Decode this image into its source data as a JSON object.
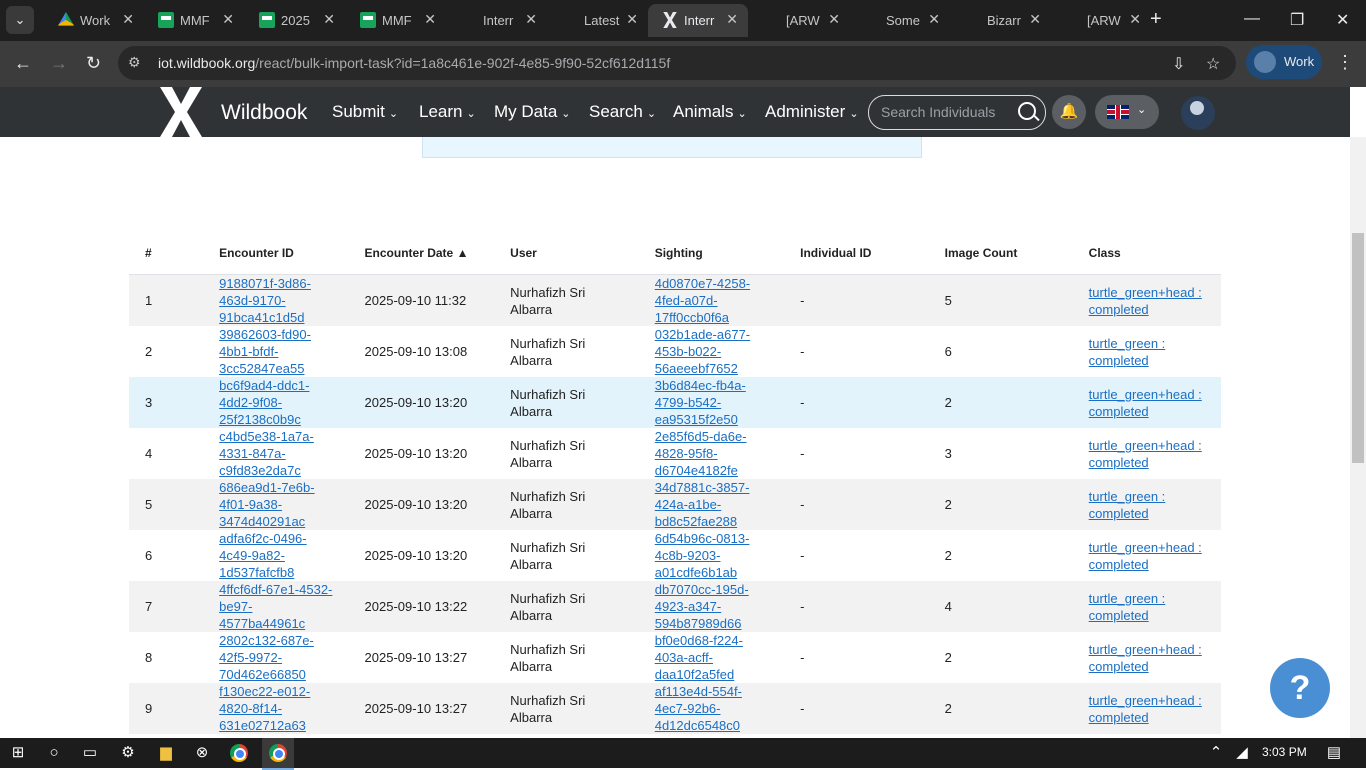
{
  "browser": {
    "tabs": [
      {
        "label": "Work",
        "icon": "google-drive-icon"
      },
      {
        "label": "MMF",
        "icon": "google-sheets-icon"
      },
      {
        "label": "2025",
        "icon": "google-sheets-icon"
      },
      {
        "label": "MMF",
        "icon": "google-sheets-icon"
      },
      {
        "label": "Interr",
        "icon": "blank-icon"
      },
      {
        "label": "Latest",
        "icon": "blank-icon"
      },
      {
        "label": "Interr",
        "icon": "wildbook-icon",
        "active": true
      },
      {
        "label": "[ARW",
        "icon": "blank-icon"
      },
      {
        "label": "Some",
        "icon": "blank-icon"
      },
      {
        "label": "Bizarr",
        "icon": "blank-icon"
      },
      {
        "label": "[ARW",
        "icon": "blank-icon"
      }
    ],
    "url_host": "iot.wildbook.org",
    "url_path": "/react/bulk-import-task?id=1a8c461e-902f-4e85-9f90-52cf612d115f",
    "profile_label": "Work"
  },
  "site": {
    "brand": "Wildbook",
    "nav": [
      "Submit",
      "Learn",
      "My Data",
      "Search",
      "Animals",
      "Administer"
    ],
    "search_placeholder": "Search Individuals"
  },
  "table": {
    "headers": [
      "#",
      "Encounter ID",
      "Encounter Date ▲",
      "User",
      "Sighting",
      "Individual ID",
      "Image Count",
      "Class"
    ],
    "rows": [
      {
        "n": "1",
        "enc_lines": [
          "9188071f-3d86-",
          "463d-9170-",
          "91bca41c1d5d"
        ],
        "date": "2025-09-10 11:32",
        "user_lines": [
          "Nurhafizh Sri",
          "Albarra"
        ],
        "sight_lines": [
          "4d0870e7-4258-",
          "4fed-a07d-",
          "17ff0ccb0f6a"
        ],
        "ind": "-",
        "count": "5",
        "class_lines": [
          "turtle_green+head :",
          "completed"
        ]
      },
      {
        "n": "2",
        "enc_lines": [
          "39862603-fd90-",
          "4bb1-bfdf-",
          "3cc52847ea55"
        ],
        "date": "2025-09-10 13:08",
        "user_lines": [
          "Nurhafizh Sri",
          "Albarra"
        ],
        "sight_lines": [
          "032b1ade-a677-",
          "453b-b022-",
          "56aeeebf7652"
        ],
        "ind": "-",
        "count": "6",
        "class_lines": [
          "turtle_green :",
          "completed"
        ]
      },
      {
        "n": "3",
        "enc_lines": [
          "bc6f9ad4-ddc1-",
          "4dd2-9f08-",
          "25f2138c0b9c"
        ],
        "date": "2025-09-10 13:20",
        "user_lines": [
          "Nurhafizh Sri",
          "Albarra"
        ],
        "sight_lines": [
          "3b6d84ec-fb4a-",
          "4799-b542-",
          "ea95315f2e50"
        ],
        "ind": "-",
        "count": "2",
        "class_lines": [
          "turtle_green+head :",
          "completed"
        ]
      },
      {
        "n": "4",
        "enc_lines": [
          "c4bd5e38-1a7a-",
          "4331-847a-",
          "c9fd83e2da7c"
        ],
        "date": "2025-09-10 13:20",
        "user_lines": [
          "Nurhafizh Sri",
          "Albarra"
        ],
        "sight_lines": [
          "2e85f6d5-da6e-",
          "4828-95f8-",
          "d6704e4182fe"
        ],
        "ind": "-",
        "count": "3",
        "class_lines": [
          "turtle_green+head :",
          "completed"
        ]
      },
      {
        "n": "5",
        "enc_lines": [
          "686ea9d1-7e6b-",
          "4f01-9a38-",
          "3474d40291ac"
        ],
        "date": "2025-09-10 13:20",
        "user_lines": [
          "Nurhafizh Sri",
          "Albarra"
        ],
        "sight_lines": [
          "34d7881c-3857-",
          "424a-a1be-",
          "bd8c52fae288"
        ],
        "ind": "-",
        "count": "2",
        "class_lines": [
          "turtle_green :",
          "completed"
        ]
      },
      {
        "n": "6",
        "enc_lines": [
          "adfa6f2c-0496-",
          "4c49-9a82-",
          "1d537fafcfb8"
        ],
        "date": "2025-09-10 13:20",
        "user_lines": [
          "Nurhafizh Sri",
          "Albarra"
        ],
        "sight_lines": [
          "6d54b96c-0813-",
          "4c8b-9203-",
          "a01cdfe6b1ab"
        ],
        "ind": "-",
        "count": "2",
        "class_lines": [
          "turtle_green+head :",
          "completed"
        ]
      },
      {
        "n": "7",
        "enc_lines": [
          "4ffcf6df-67e1-4532-",
          "be97-",
          "4577ba44961c"
        ],
        "date": "2025-09-10 13:22",
        "user_lines": [
          "Nurhafizh Sri",
          "Albarra"
        ],
        "sight_lines": [
          "db7070cc-195d-",
          "4923-a347-",
          "594b87989d66"
        ],
        "ind": "-",
        "count": "4",
        "class_lines": [
          "turtle_green :",
          "completed"
        ]
      },
      {
        "n": "8",
        "enc_lines": [
          "2802c132-687e-",
          "42f5-9972-",
          "70d462e66850"
        ],
        "date": "2025-09-10 13:27",
        "user_lines": [
          "Nurhafizh Sri",
          "Albarra"
        ],
        "sight_lines": [
          "bf0e0d68-f224-",
          "403a-acff-",
          "daa10f2a5fed"
        ],
        "ind": "-",
        "count": "2",
        "class_lines": [
          "turtle_green+head :",
          "completed"
        ]
      },
      {
        "n": "9",
        "enc_lines": [
          "f130ec22-e012-",
          "4820-8f14-",
          "631e02712a63"
        ],
        "date": "2025-09-10 13:27",
        "user_lines": [
          "Nurhafizh Sri",
          "Albarra"
        ],
        "sight_lines": [
          "af113e4d-554f-",
          "4ec7-92b6-",
          "4d12dc6548c0"
        ],
        "ind": "-",
        "count": "2",
        "class_lines": [
          "turtle_green+head :",
          "completed"
        ]
      }
    ]
  },
  "help_label": "?",
  "taskbar": {
    "clock": "3:03 PM"
  },
  "colors": {
    "link": "#1a6fc4",
    "header_bg": "#303336",
    "row_stripe": "#f2f2f2",
    "row_highlight": "#e3f3fc"
  }
}
